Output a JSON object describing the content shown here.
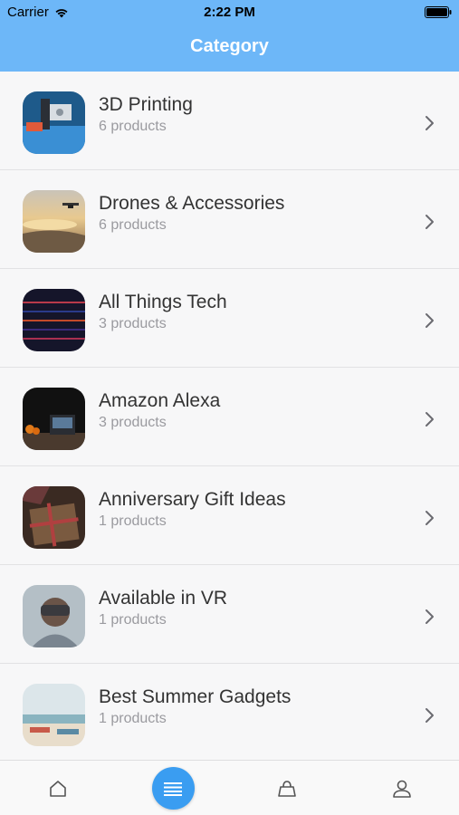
{
  "status": {
    "carrier": "Carrier",
    "time": "2:22 PM"
  },
  "header": {
    "title": "Category"
  },
  "categories": [
    {
      "title": "3D Printing",
      "subtitle": "6 products"
    },
    {
      "title": "Drones & Accessories",
      "subtitle": "6 products"
    },
    {
      "title": "All Things Tech",
      "subtitle": "3 products"
    },
    {
      "title": "Amazon Alexa",
      "subtitle": "3 products"
    },
    {
      "title": "Anniversary Gift Ideas",
      "subtitle": "1 products"
    },
    {
      "title": "Available in VR",
      "subtitle": "1 products"
    },
    {
      "title": "Best Summer Gadgets",
      "subtitle": "1 products"
    }
  ],
  "tabbar": {
    "items": [
      "home-icon",
      "list-icon",
      "bag-icon",
      "user-icon"
    ],
    "active": "list-icon"
  },
  "colors": {
    "accent": "#6db7f8",
    "active_tab": "#3a9df1"
  }
}
